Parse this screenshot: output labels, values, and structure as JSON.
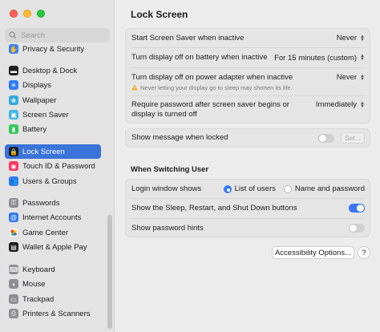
{
  "window": {
    "traffic_lights": [
      "close",
      "minimize",
      "zoom"
    ]
  },
  "search": {
    "placeholder": "Search"
  },
  "sidebar": {
    "items": [
      {
        "label": "Privacy & Security",
        "icon": "hand-icon",
        "color": "#3b82f6"
      },
      {
        "label": "Desktop & Dock",
        "icon": "dock-icon",
        "color": "#1f1f1f"
      },
      {
        "label": "Displays",
        "icon": "display-icon",
        "color": "#2f7cf6"
      },
      {
        "label": "Wallpaper",
        "icon": "wallpaper-icon",
        "color": "#34aadc"
      },
      {
        "label": "Screen Saver",
        "icon": "screensaver-icon",
        "color": "#3fb8e8"
      },
      {
        "label": "Battery",
        "icon": "battery-icon",
        "color": "#34c759"
      },
      {
        "label": "Lock Screen",
        "icon": "lock-icon",
        "color": "#1c1c1e",
        "active": true
      },
      {
        "label": "Touch ID & Password",
        "icon": "fingerprint-icon",
        "color": "#ff375f"
      },
      {
        "label": "Users & Groups",
        "icon": "users-icon",
        "color": "#2f7cf6"
      },
      {
        "label": "Passwords",
        "icon": "key-icon",
        "color": "#8e8e93"
      },
      {
        "label": "Internet Accounts",
        "icon": "at-icon",
        "color": "#2f7cf6"
      },
      {
        "label": "Game Center",
        "icon": "game-center-icon",
        "color": "#ffffff"
      },
      {
        "label": "Wallet & Apple Pay",
        "icon": "wallet-icon",
        "color": "#1c1c1e"
      },
      {
        "label": "Keyboard",
        "icon": "keyboard-icon",
        "color": "#8e8e93"
      },
      {
        "label": "Mouse",
        "icon": "mouse-icon",
        "color": "#8e8e93"
      },
      {
        "label": "Trackpad",
        "icon": "trackpad-icon",
        "color": "#8e8e93"
      },
      {
        "label": "Printers & Scanners",
        "icon": "printer-icon",
        "color": "#8e8e93"
      }
    ]
  },
  "main": {
    "title": "Lock Screen",
    "group1": {
      "screen_saver": {
        "label": "Start Screen Saver when inactive",
        "value": "Never"
      },
      "display_battery": {
        "label": "Turn display off on battery when inactive",
        "value": "For 15 minutes (custom)"
      },
      "display_power": {
        "label": "Turn display off on power adapter when inactive",
        "value": "Never",
        "note": "Never letting your display go to sleep may shorten its life."
      },
      "require_password": {
        "label_line1": "Require password after screen saver begins or",
        "label_line2": "display is turned off",
        "value": "Immediately"
      }
    },
    "message": {
      "label": "Show message when locked",
      "toggle_on": false,
      "set_label": "Set..."
    },
    "switching": {
      "heading": "When Switching User",
      "login_window": {
        "label": "Login window shows",
        "options": [
          "List of users",
          "Name and password"
        ],
        "selected": "List of users"
      },
      "sleep_restart": {
        "label": "Show the Sleep, Restart, and Shut Down buttons",
        "toggle_on": true
      },
      "password_hints": {
        "label": "Show password hints",
        "toggle_on": false
      }
    },
    "accessibility_button": "Accessibility Options...",
    "help_button": "?"
  },
  "colors": {
    "accent": "#3478f6",
    "sidebar_active": "#3a73d9"
  }
}
